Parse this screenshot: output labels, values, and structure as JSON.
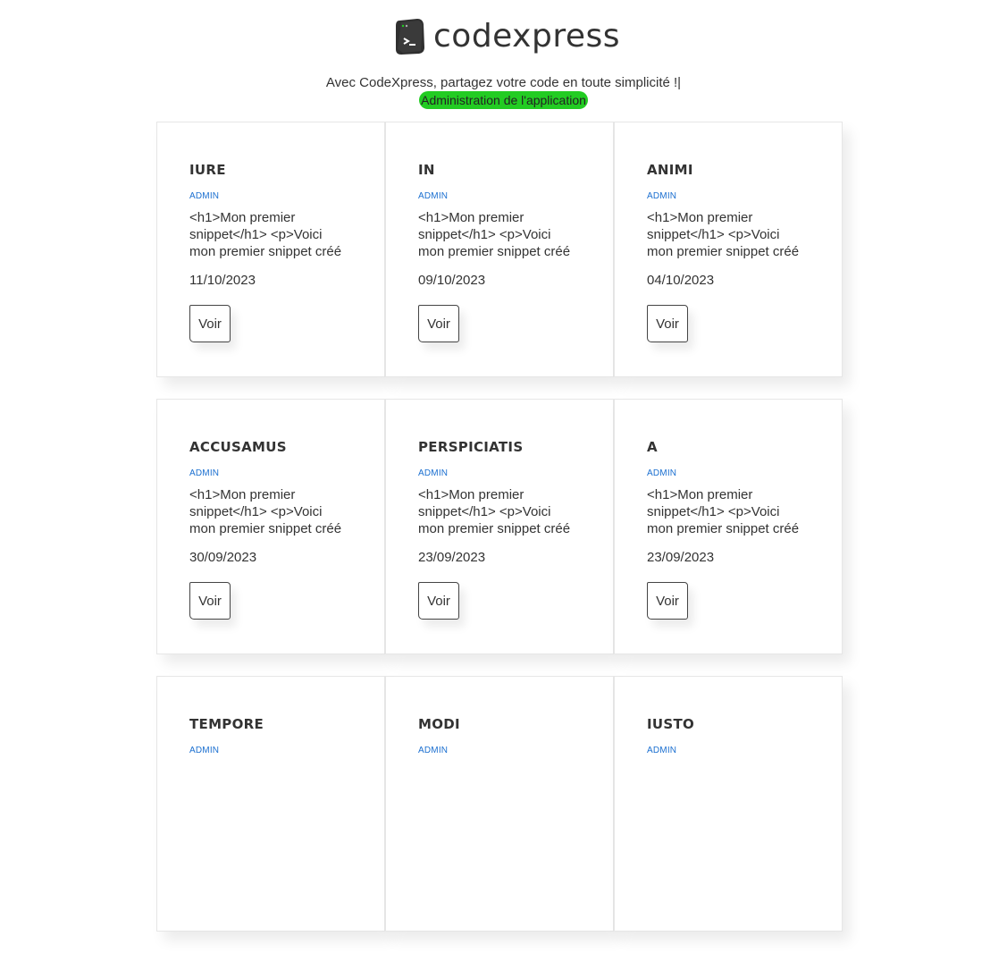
{
  "header": {
    "brand": "codexpress",
    "tagline": "Avec CodeXpress, partagez votre code en toute simplicité !|",
    "admin_link": "Administration de l'application"
  },
  "colors": {
    "admin_link_bg": "#22cc22",
    "author": "#1a6fd0"
  },
  "cards": [
    {
      "title": "IURE",
      "author": "ADMIN",
      "excerpt": "<h1>Mon premier snippet</h1> <p>Voici mon premier snippet créé",
      "date": "11/10/2023",
      "button": "Voir"
    },
    {
      "title": "IN",
      "author": "ADMIN",
      "excerpt": "<h1>Mon premier snippet</h1> <p>Voici mon premier snippet créé",
      "date": "09/10/2023",
      "button": "Voir"
    },
    {
      "title": "ANIMI",
      "author": "ADMIN",
      "excerpt": "<h1>Mon premier snippet</h1> <p>Voici mon premier snippet créé",
      "date": "04/10/2023",
      "button": "Voir"
    },
    {
      "title": "ACCUSAMUS",
      "author": "ADMIN",
      "excerpt": "<h1>Mon premier snippet</h1> <p>Voici mon premier snippet créé",
      "date": "30/09/2023",
      "button": "Voir"
    },
    {
      "title": "PERSPICIATIS",
      "author": "ADMIN",
      "excerpt": "<h1>Mon premier snippet</h1> <p>Voici mon premier snippet créé",
      "date": "23/09/2023",
      "button": "Voir"
    },
    {
      "title": "A",
      "author": "ADMIN",
      "excerpt": "<h1>Mon premier snippet</h1> <p>Voici mon premier snippet créé",
      "date": "23/09/2023",
      "button": "Voir"
    },
    {
      "title": "TEMPORE",
      "author": "ADMIN",
      "excerpt": "",
      "date": "",
      "button": ""
    },
    {
      "title": "MODI",
      "author": "ADMIN",
      "excerpt": "",
      "date": "",
      "button": ""
    },
    {
      "title": "IUSTO",
      "author": "ADMIN",
      "excerpt": "",
      "date": "",
      "button": ""
    }
  ]
}
